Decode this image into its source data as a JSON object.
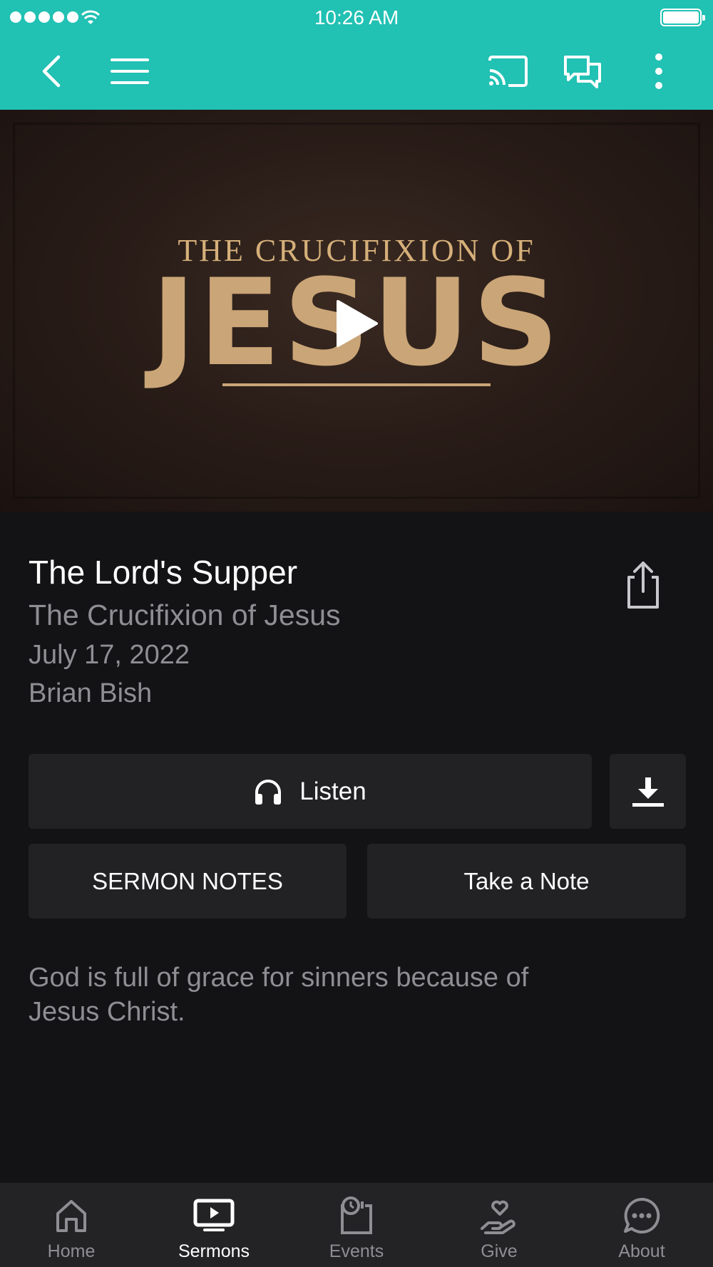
{
  "status_bar": {
    "time": "10:26 AM"
  },
  "app_bar": {
    "icons": [
      "back-icon",
      "menu-icon",
      "cast-icon",
      "chat-icon",
      "more-icon"
    ]
  },
  "hero": {
    "title_top": "THE CRUCIFIXION OF",
    "title_main": "JESUS"
  },
  "sermon": {
    "title": "The Lord's Supper",
    "series": "The Crucifixion of Jesus",
    "date": "July 17, 2022",
    "speaker": "Brian Bish",
    "description": "God is full of grace for sinners because of Jesus Christ."
  },
  "actions": {
    "listen_label": "Listen",
    "notes_label": "SERMON NOTES",
    "take_note_label": "Take a Note"
  },
  "bottom_nav": {
    "items": [
      {
        "label": "Home",
        "icon": "home-icon"
      },
      {
        "label": "Sermons",
        "icon": "sermons-icon",
        "active": true
      },
      {
        "label": "Events",
        "icon": "events-icon"
      },
      {
        "label": "Give",
        "icon": "give-icon"
      },
      {
        "label": "About",
        "icon": "about-icon"
      }
    ]
  },
  "colors": {
    "accent": "#21c1b3",
    "background": "#131315",
    "button": "#222224",
    "muted_text": "#8e8e93",
    "nav_background": "#232325"
  }
}
